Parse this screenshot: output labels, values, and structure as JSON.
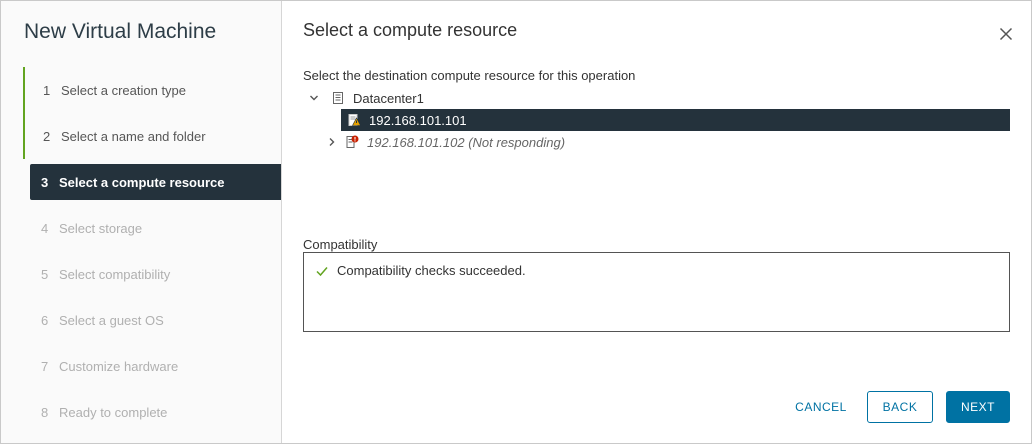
{
  "wizard": {
    "title": "New Virtual Machine",
    "steps": [
      {
        "num": "1",
        "label": "Select a creation type",
        "state": "done"
      },
      {
        "num": "2",
        "label": "Select a name and folder",
        "state": "done"
      },
      {
        "num": "3",
        "label": "Select a compute resource",
        "state": "active"
      },
      {
        "num": "4",
        "label": "Select storage",
        "state": "todo"
      },
      {
        "num": "5",
        "label": "Select compatibility",
        "state": "todo"
      },
      {
        "num": "6",
        "label": "Select a guest OS",
        "state": "todo"
      },
      {
        "num": "7",
        "label": "Customize hardware",
        "state": "todo"
      },
      {
        "num": "8",
        "label": "Ready to complete",
        "state": "todo"
      }
    ]
  },
  "main": {
    "title": "Select a compute resource",
    "instruction": "Select the destination compute resource for this operation",
    "tree": {
      "datacenter": {
        "label": "Datacenter1",
        "icon": "datacenter-icon",
        "expanded": true
      },
      "hosts": [
        {
          "label": "192.168.101.101",
          "icon": "host-warning-icon",
          "selected": true
        },
        {
          "label": "192.168.101.102 (Not responding)",
          "icon": "host-error-icon",
          "selected": false
        }
      ]
    },
    "compatibility": {
      "label": "Compatibility",
      "message": "Compatibility checks succeeded.",
      "icon": "check-icon"
    }
  },
  "buttons": {
    "cancel": "CANCEL",
    "back": "BACK",
    "next": "NEXT"
  },
  "colors": {
    "accent": "#0072a3",
    "selected_bg": "#24323c",
    "done_marker": "#62a420",
    "success_check": "#62a420",
    "warning": "#e6a100",
    "error": "#c92100"
  }
}
